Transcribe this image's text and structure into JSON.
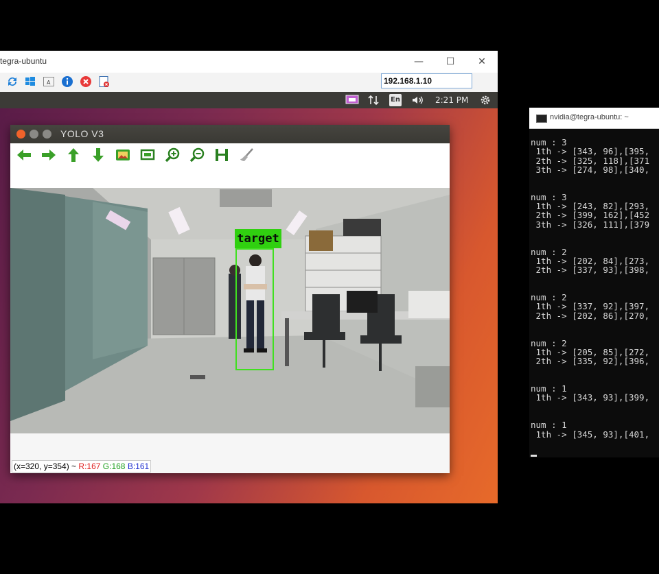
{
  "viewer": {
    "title": "tegra-ubuntu",
    "minimize": "—",
    "maximize": "☐",
    "close": "✕",
    "ip_address": "192.168.1.10"
  },
  "panel": {
    "lang": "En",
    "time": "2:21 PM"
  },
  "yolo": {
    "title": "YOLO V3",
    "detection_label": "target",
    "status": {
      "coords": "(x=320, y=354) ~",
      "r": "R:167",
      "g": "G:168",
      "b": "B:161"
    }
  },
  "terminal": {
    "title": "nvidia@tegra-ubuntu: ~",
    "blocks": [
      [
        "num : 3",
        " 1th -> [343, 96],[395,",
        " 2th -> [325, 118],[371",
        " 3th -> [274, 98],[340,"
      ],
      [
        "num : 3",
        " 1th -> [243, 82],[293,",
        " 2th -> [399, 162],[452",
        " 3th -> [326, 111],[379"
      ],
      [
        "num : 2",
        " 1th -> [202, 84],[273,",
        " 2th -> [337, 93],[398,"
      ],
      [
        "num : 2",
        " 1th -> [337, 92],[397,",
        " 2th -> [202, 86],[270,"
      ],
      [
        "num : 2",
        " 1th -> [205, 85],[272,",
        " 2th -> [335, 92],[396,"
      ],
      [
        "num : 1",
        " 1th -> [343, 93],[399,"
      ],
      [
        "num : 1",
        " 1th -> [345, 93],[401,"
      ]
    ]
  },
  "colors": {
    "status_r": "#e02020",
    "status_g": "#20a020",
    "status_b": "#2030d0",
    "bbox": "#40e020"
  }
}
